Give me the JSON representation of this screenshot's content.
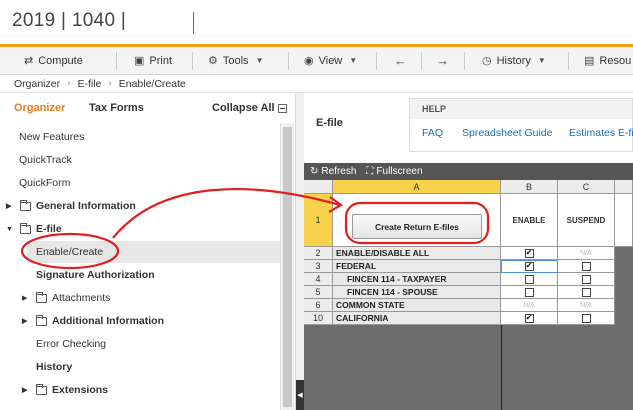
{
  "titlebar": {
    "title": "2019 | 1040 |"
  },
  "toolbar": {
    "compute": "Compute",
    "print": "Print",
    "tools": "Tools",
    "view": "View",
    "history": "History",
    "resources": "Resou"
  },
  "breadcrumb": [
    "Organizer",
    "E-file",
    "Enable/Create"
  ],
  "sidebar": {
    "tab_organizer": "Organizer",
    "tab_taxforms": "Tax Forms",
    "collapse_all": "Collapse All",
    "items": [
      {
        "label": "New Features"
      },
      {
        "label": "QuickTrack"
      },
      {
        "label": "QuickForm"
      },
      {
        "label": "General Information"
      },
      {
        "label": "E-file"
      },
      {
        "label": "Enable/Create"
      },
      {
        "label": "Signature Authorization"
      },
      {
        "label": "Attachments"
      },
      {
        "label": "Additional Information"
      },
      {
        "label": "Error Checking"
      },
      {
        "label": "History"
      },
      {
        "label": "Extensions"
      }
    ]
  },
  "main": {
    "title": "E-file",
    "help": {
      "header": "HELP",
      "links": [
        "FAQ",
        "Spreadsheet Guide",
        "Estimates E-file"
      ]
    },
    "grid_toolbar": {
      "refresh": "Refresh",
      "fullscreen": "Fullscreen"
    },
    "columns": [
      "A",
      "B",
      "C"
    ],
    "col_b_head": "ENABLE",
    "col_c_head": "SUSPEND",
    "create_button": "Create Return E-files",
    "rows": [
      {
        "num": "1"
      },
      {
        "num": "2",
        "label": "ENABLE/DISABLE ALL",
        "b": "checked",
        "c": "N/A"
      },
      {
        "num": "3",
        "label": "FEDERAL",
        "b": "checked",
        "c": ""
      },
      {
        "num": "4",
        "label": "FINCEN 114 - TAXPAYER",
        "b": "",
        "c": ""
      },
      {
        "num": "5",
        "label": "FINCEN 114 - SPOUSE",
        "b": "",
        "c": ""
      },
      {
        "num": "6",
        "label": "COMMON STATE",
        "b": "N/A",
        "c": "N/A"
      },
      {
        "num": "10",
        "label": "CALIFORNIA",
        "b": "checked",
        "c": ""
      }
    ]
  },
  "colors": {
    "accent": "#f39c12",
    "annotation": "#e02020",
    "link": "#1a6fb5",
    "column_header_highlight": "#f7d24a"
  }
}
